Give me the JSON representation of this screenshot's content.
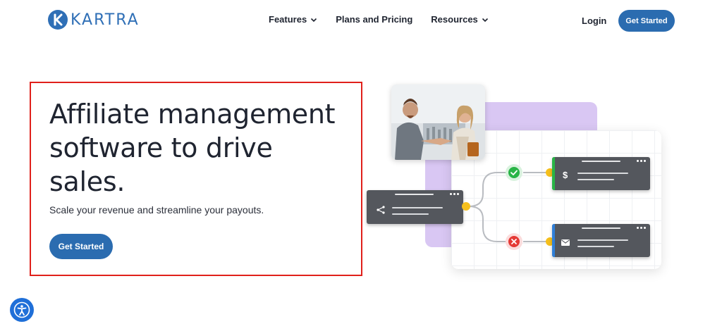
{
  "brand": {
    "name": "KARTRA",
    "color": "#2f6fb6"
  },
  "nav": {
    "items": [
      {
        "label": "Features",
        "has_dropdown": true
      },
      {
        "label": "Plans and Pricing",
        "has_dropdown": false
      },
      {
        "label": "Resources",
        "has_dropdown": true
      }
    ],
    "login_label": "Login",
    "cta_label": "Get Started"
  },
  "hero": {
    "title": "Affiliate management software to drive sales.",
    "subtitle": "Scale your revenue and streamline your payouts.",
    "cta_label": "Get Started",
    "highlight_color": "#e0201b"
  },
  "illustration": {
    "photo_alt_icon": "handshake-photo",
    "source_card_icon": "share-icon",
    "approved_status_icon": "check-icon",
    "rejected_status_icon": "x-icon",
    "payout_card_icon": "dollar-icon",
    "payout_card_symbol": "$",
    "notify_card_icon": "mail-icon",
    "colors": {
      "purple": "#d9c7f3",
      "card": "#54575d",
      "success": "#28b446",
      "danger": "#e53935",
      "info": "#2f7fd8",
      "connector": "#f5bf1c"
    }
  },
  "accessibility": {
    "icon": "accessibility-icon"
  },
  "colors": {
    "primary": "#2b6cb0",
    "text": "#1f2430"
  }
}
